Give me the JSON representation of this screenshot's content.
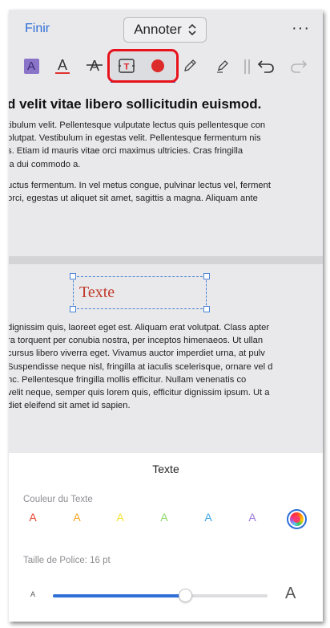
{
  "topbar": {
    "finish_label": "Finir",
    "mode_label": "Annoter",
    "more_label": "···"
  },
  "toolbar": {
    "tools": [
      {
        "name": "highlight",
        "glyph": "A"
      },
      {
        "name": "underline",
        "glyph": "A"
      },
      {
        "name": "strikethrough",
        "glyph": "A"
      },
      {
        "name": "text-box",
        "glyph": "T",
        "selected": true
      },
      {
        "name": "record",
        "selected": true
      },
      {
        "name": "pencil"
      },
      {
        "name": "marker"
      },
      {
        "name": "undo"
      },
      {
        "name": "redo"
      }
    ],
    "accent": "#3a67d8",
    "annotation_ring": "#e8121c"
  },
  "document": {
    "heading": "d velit vitae libero sollicitudin euismod.",
    "para1": [
      "tibulum velit. Pellentesque vulputate lectus quis pellentesque con",
      "olutpat. Vestibulum in egestas velit. Pellentesque fermentum nis",
      "s. Etiam id mauris vitae orci maximus ultricies. Cras fringilla",
      "la dui commodo a."
    ],
    "para2": [
      "uctus fermentum. In vel metus congue, pulvinar lectus vel, ferment",
      "orci, egestas ut aliquet sit amet, sagittis a magna. Aliquam ante"
    ],
    "textbox_label": "Texte",
    "textbox_color": "#c0392b",
    "para3": [
      "dignissim quis, laoreet eget est. Aliquam erat volutpat. Class apter",
      "ra torquent per conubia nostra, per inceptos himenaeos. Ut ullan",
      "cursus libero viverra eget. Vivamus auctor imperdiet urna, at pulv",
      "Suspendisse neque nisl, fringilla at iaculis scelerisque, ornare vel d",
      "nc. Pellentesque fringilla mollis efficitur. Nullam venenatis co",
      "velit neque, semper quis lorem quis, efficitur dignissim ipsum. Ut a",
      "diet eleifend sit amet id sapien."
    ]
  },
  "panel": {
    "title": "Texte",
    "color_label": "Couleur du Texte",
    "colors": [
      {
        "glyph": "A",
        "color": "#e8412f"
      },
      {
        "glyph": "A",
        "color": "#f5a623"
      },
      {
        "glyph": "A",
        "color": "#f2e22a"
      },
      {
        "glyph": "A",
        "color": "#8bd86a"
      },
      {
        "glyph": "A",
        "color": "#3aa3e8"
      },
      {
        "glyph": "A",
        "color": "#9a77d8"
      }
    ],
    "font_size_label": "Taille de Police: 16 pt",
    "slider_min_glyph": "A",
    "slider_max_glyph": "A",
    "font_size_fraction": 0.62
  }
}
